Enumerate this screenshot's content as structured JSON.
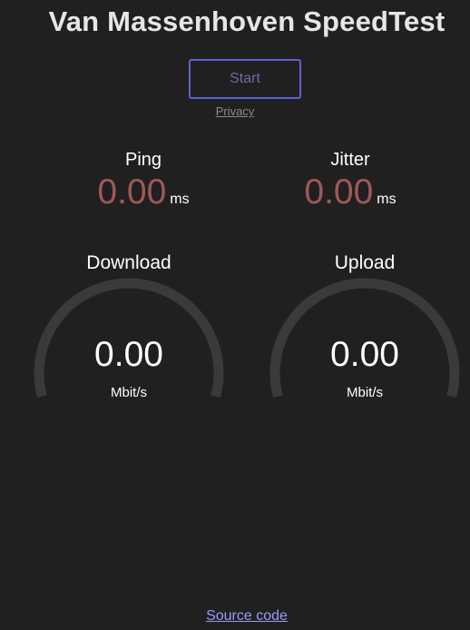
{
  "header": {
    "title": "Van Massenhoven SpeedTest"
  },
  "controls": {
    "start_label": "Start",
    "privacy_label": "Privacy"
  },
  "metrics": {
    "ping": {
      "label": "Ping",
      "value": "0.00",
      "unit": "ms"
    },
    "jitter": {
      "label": "Jitter",
      "value": "0.00",
      "unit": "ms"
    }
  },
  "gauges": {
    "download": {
      "label": "Download",
      "value": "0.00",
      "unit": "Mbit/s",
      "level": 0
    },
    "upload": {
      "label": "Upload",
      "value": "0.00",
      "unit": "Mbit/s",
      "level": 0
    }
  },
  "footer": {
    "source_label": "Source code"
  },
  "colors": {
    "background": "#202020",
    "accent_border": "#6060d0",
    "metric_value": "#a05858",
    "gauge_track": "#3a3a3a",
    "link": "#9a9aff"
  }
}
